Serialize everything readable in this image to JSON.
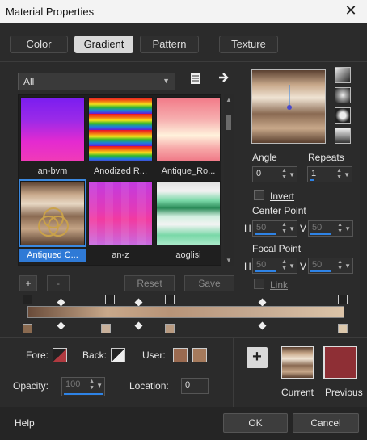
{
  "window": {
    "title": "Material Properties",
    "close_glyph": "✕"
  },
  "tabs": [
    "Color",
    "Gradient",
    "Pattern",
    "Texture"
  ],
  "active_tab": "Gradient",
  "library": {
    "category": "All",
    "items": [
      {
        "label": "an-bvm"
      },
      {
        "label": "Anodized R..."
      },
      {
        "label": "Antique_Ro..."
      },
      {
        "label": "Antiqued C...",
        "selected": true
      },
      {
        "label": "an-z"
      },
      {
        "label": "aoglisi"
      }
    ]
  },
  "buttons": {
    "add": "+",
    "remove": "-",
    "reset": "Reset",
    "save": "Save"
  },
  "settings": {
    "angle_label": "Angle",
    "angle": "0",
    "repeats_label": "Repeats",
    "repeats": "1",
    "invert_label": "Invert",
    "center_label": "Center Point",
    "center_h": "50",
    "center_v": "50",
    "focal_label": "Focal Point",
    "focal_h": "50",
    "focal_v": "50",
    "link_label": "Link",
    "h_label": "H",
    "v_label": "V"
  },
  "bottom": {
    "fore_label": "Fore:",
    "back_label": "Back:",
    "user_label": "User:",
    "opacity_label": "Opacity:",
    "opacity": "100",
    "location_label": "Location:",
    "location": "0",
    "plus": "+",
    "current_label": "Current",
    "previous_label": "Previous",
    "user_color_1": "#9a6a50",
    "user_color_2": "#a57a5c",
    "previous_color": "#8e2f35"
  },
  "footer": {
    "help": "Help",
    "ok": "OK",
    "cancel": "Cancel"
  },
  "icons": {
    "book": "book-icon",
    "arrow": "right-arrow-icon"
  }
}
